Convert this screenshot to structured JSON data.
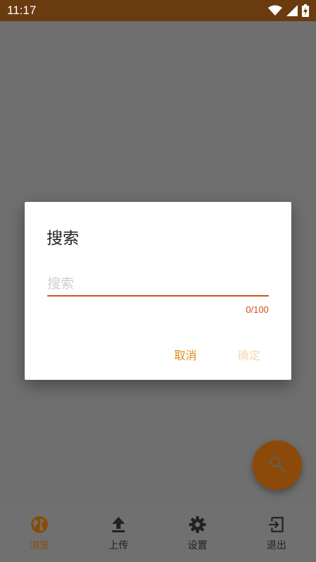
{
  "status_bar": {
    "time": "11:17",
    "icons": [
      "wifi-icon",
      "signal-icon",
      "battery-charging-icon"
    ]
  },
  "dialog": {
    "title": "搜索",
    "input_placeholder": "搜索",
    "input_value": "",
    "counter": "0/100",
    "cancel_label": "取消",
    "confirm_label": "确定"
  },
  "fab": {
    "icon": "search-icon"
  },
  "bottom_nav": {
    "items": [
      {
        "label": "浏览",
        "icon": "globe-icon",
        "active": true
      },
      {
        "label": "上传",
        "icon": "upload-icon",
        "active": false
      },
      {
        "label": "设置",
        "icon": "gear-icon",
        "active": false
      },
      {
        "label": "退出",
        "icon": "logout-icon",
        "active": false
      }
    ]
  },
  "colors": {
    "status_bar": "#6b3b10",
    "accent": "#d2541e",
    "primary": "#8b4a09",
    "cancel_text": "#dc8a1a",
    "confirm_disabled_text": "#f1d9b1",
    "scrim": "#6f6f6f"
  }
}
